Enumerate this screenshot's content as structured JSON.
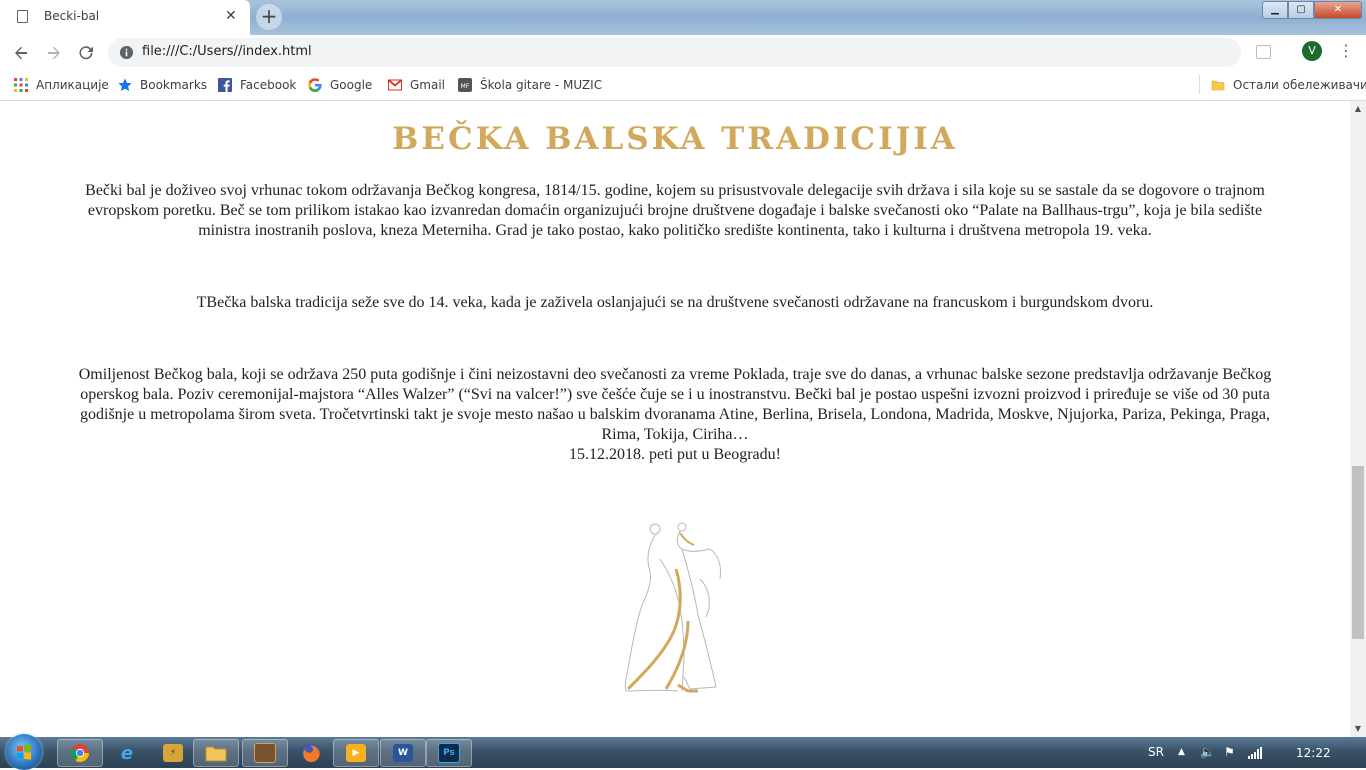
{
  "browser": {
    "tab_title": "Becki-bal",
    "tab_close": "✕",
    "new_tab": "+",
    "url": "file:///C:/Users//index.html",
    "avatar_letter": "V",
    "window_controls": {
      "minimize": "▁",
      "maximize": "▢",
      "close": "✕"
    }
  },
  "bookmarks": {
    "apps": "Апликације",
    "items": [
      "Bookmarks",
      "Facebook",
      "Google",
      "Gmail",
      "Škola gitare - MUZIC"
    ],
    "other": "Остали обележивачи"
  },
  "page": {
    "heading": "BEČKA BALSKA TRADICIJIA",
    "paragraph1": "Bečki bal je doživeo svoj vrhunac tokom održavanja Bečkog kongresa, 1814/15. godine, kojem su prisustvovale delegacije svih država i sila koje su se sastale da se dogovore o trajnom evropskom poretku. Beč se tom prilikom istakao kao izvanredan domaćin organizujući brojne društvene događaje i balske svečanosti oko “Palate na Ballhaus-trgu”, koja je bila sedište ministra inostranih poslova, kneza Meterniha. Grad je tako postao, kako političko središte kontinenta, tako i kulturna i društvena metropola 19. veka.",
    "paragraph2": "TBečka balska tradicija seže sve do 14. veka, kada je zaživela oslanjajući se na društvene svečanosti održavane na francuskom i burgundskom dvoru.",
    "paragraph3": "Omiljenost Bečkog bala, koji se održava 250 puta godišnje i čini neizostavni deo svečanosti za vreme Poklada, traje sve do danas, a vrhunac balske sezone predstavlja održavanje Bečkog operskog bala. Poziv ceremonijal-majstora “Alles Walzer” (“Svi na valcer!”) sve češće čuje se i u inostranstvu. Bečki bal je postao uspešni izvozni proizvod i priređuje se više od 30 puta godišnje u metropolama širom sveta. Tročetvrtinski takt je svoje mesto našao u balskim dvoranama Atine, Berlina, Brisela, Londona, Madrida, Moskve, Njujorka, Pariza, Pekinga, Praga, Rima, Tokija, Ciriha…",
    "paragraph3_line2": "15.12.2018. peti put u Beogradu!"
  },
  "taskbar": {
    "language": "SR",
    "time": "12:22",
    "apps": [
      "chrome",
      "internet-explorer",
      "winamp",
      "file-explorer",
      "media-app",
      "firefox",
      "vlc",
      "word",
      "photoshop"
    ],
    "word_label": "W",
    "ps_label": "Ps"
  },
  "colors": {
    "heading": "#d2a85c",
    "chrome_frame": "#a9c3dd",
    "taskbar": "#3a5268"
  }
}
